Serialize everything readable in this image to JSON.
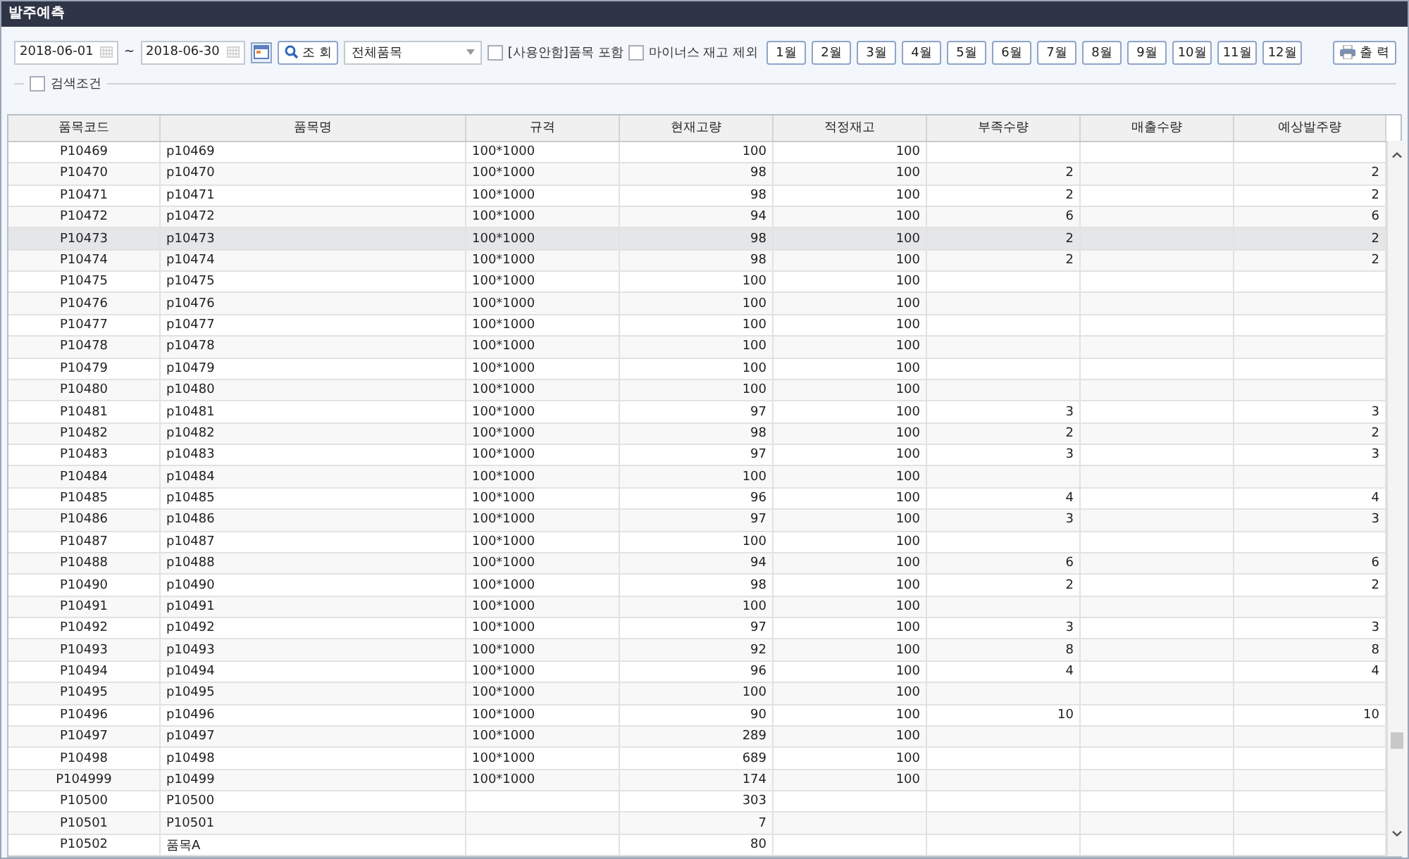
{
  "window": {
    "title": "발주예측"
  },
  "toolbar": {
    "date_from": "2018-06-01",
    "separator": "~",
    "date_to": "2018-06-30",
    "search_button": "조 회",
    "category_select": "전체품목",
    "checkboxes": [
      {
        "label": "[사용안함]품목 포함",
        "checked": false
      },
      {
        "label": "마이너스 재고 제외",
        "checked": false
      }
    ],
    "months": [
      "1월",
      "2월",
      "3월",
      "4월",
      "5월",
      "6월",
      "7월",
      "8월",
      "9월",
      "10월",
      "11월",
      "12월"
    ],
    "print_button": "출 력"
  },
  "search_conditions": {
    "label": "검색조건",
    "checked": false
  },
  "table": {
    "columns": [
      "품목코드",
      "품목명",
      "규격",
      "현재고량",
      "적정재고",
      "부족수량",
      "매출수량",
      "예상발주량"
    ],
    "rows": [
      {
        "cells": [
          "P10469",
          "p10469",
          "100*1000",
          "100",
          "100",
          "",
          "",
          ""
        ],
        "selected": false
      },
      {
        "cells": [
          "P10470",
          "p10470",
          "100*1000",
          "98",
          "100",
          "2",
          "",
          "2"
        ],
        "selected": false
      },
      {
        "cells": [
          "P10471",
          "p10471",
          "100*1000",
          "98",
          "100",
          "2",
          "",
          "2"
        ],
        "selected": false
      },
      {
        "cells": [
          "P10472",
          "p10472",
          "100*1000",
          "94",
          "100",
          "6",
          "",
          "6"
        ],
        "selected": false
      },
      {
        "cells": [
          "P10473",
          "p10473",
          "100*1000",
          "98",
          "100",
          "2",
          "",
          "2"
        ],
        "selected": true
      },
      {
        "cells": [
          "P10474",
          "p10474",
          "100*1000",
          "98",
          "100",
          "2",
          "",
          "2"
        ],
        "selected": false
      },
      {
        "cells": [
          "P10475",
          "p10475",
          "100*1000",
          "100",
          "100",
          "",
          "",
          ""
        ],
        "selected": false
      },
      {
        "cells": [
          "P10476",
          "p10476",
          "100*1000",
          "100",
          "100",
          "",
          "",
          ""
        ],
        "selected": false
      },
      {
        "cells": [
          "P10477",
          "p10477",
          "100*1000",
          "100",
          "100",
          "",
          "",
          ""
        ],
        "selected": false
      },
      {
        "cells": [
          "P10478",
          "p10478",
          "100*1000",
          "100",
          "100",
          "",
          "",
          ""
        ],
        "selected": false
      },
      {
        "cells": [
          "P10479",
          "p10479",
          "100*1000",
          "100",
          "100",
          "",
          "",
          ""
        ],
        "selected": false
      },
      {
        "cells": [
          "P10480",
          "p10480",
          "100*1000",
          "100",
          "100",
          "",
          "",
          ""
        ],
        "selected": false
      },
      {
        "cells": [
          "P10481",
          "p10481",
          "100*1000",
          "97",
          "100",
          "3",
          "",
          "3"
        ],
        "selected": false
      },
      {
        "cells": [
          "P10482",
          "p10482",
          "100*1000",
          "98",
          "100",
          "2",
          "",
          "2"
        ],
        "selected": false
      },
      {
        "cells": [
          "P10483",
          "p10483",
          "100*1000",
          "97",
          "100",
          "3",
          "",
          "3"
        ],
        "selected": false
      },
      {
        "cells": [
          "P10484",
          "p10484",
          "100*1000",
          "100",
          "100",
          "",
          "",
          ""
        ],
        "selected": false
      },
      {
        "cells": [
          "P10485",
          "p10485",
          "100*1000",
          "96",
          "100",
          "4",
          "",
          "4"
        ],
        "selected": false
      },
      {
        "cells": [
          "P10486",
          "p10486",
          "100*1000",
          "97",
          "100",
          "3",
          "",
          "3"
        ],
        "selected": false
      },
      {
        "cells": [
          "P10487",
          "p10487",
          "100*1000",
          "100",
          "100",
          "",
          "",
          ""
        ],
        "selected": false
      },
      {
        "cells": [
          "P10488",
          "p10488",
          "100*1000",
          "94",
          "100",
          "6",
          "",
          "6"
        ],
        "selected": false
      },
      {
        "cells": [
          "P10490",
          "p10490",
          "100*1000",
          "98",
          "100",
          "2",
          "",
          "2"
        ],
        "selected": false
      },
      {
        "cells": [
          "P10491",
          "p10491",
          "100*1000",
          "100",
          "100",
          "",
          "",
          ""
        ],
        "selected": false
      },
      {
        "cells": [
          "P10492",
          "p10492",
          "100*1000",
          "97",
          "100",
          "3",
          "",
          "3"
        ],
        "selected": false
      },
      {
        "cells": [
          "P10493",
          "p10493",
          "100*1000",
          "92",
          "100",
          "8",
          "",
          "8"
        ],
        "selected": false
      },
      {
        "cells": [
          "P10494",
          "p10494",
          "100*1000",
          "96",
          "100",
          "4",
          "",
          "4"
        ],
        "selected": false
      },
      {
        "cells": [
          "P10495",
          "p10495",
          "100*1000",
          "100",
          "100",
          "",
          "",
          ""
        ],
        "selected": false
      },
      {
        "cells": [
          "P10496",
          "p10496",
          "100*1000",
          "90",
          "100",
          "10",
          "",
          "10"
        ],
        "selected": false
      },
      {
        "cells": [
          "P10497",
          "p10497",
          "100*1000",
          "289",
          "100",
          "",
          "",
          ""
        ],
        "selected": false
      },
      {
        "cells": [
          "P10498",
          "p10498",
          "100*1000",
          "689",
          "100",
          "",
          "",
          ""
        ],
        "selected": false
      },
      {
        "cells": [
          "P104999",
          "p10499",
          "100*1000",
          "174",
          "100",
          "",
          "",
          ""
        ],
        "selected": false
      },
      {
        "cells": [
          "P10500",
          "P10500",
          "",
          "303",
          "",
          "",
          "",
          ""
        ],
        "selected": false
      },
      {
        "cells": [
          "P10501",
          "P10501",
          "",
          "7",
          "",
          "",
          "",
          ""
        ],
        "selected": false
      },
      {
        "cells": [
          "P10502",
          "품목A",
          "",
          "80",
          "",
          "",
          "",
          ""
        ],
        "selected": false
      }
    ]
  }
}
